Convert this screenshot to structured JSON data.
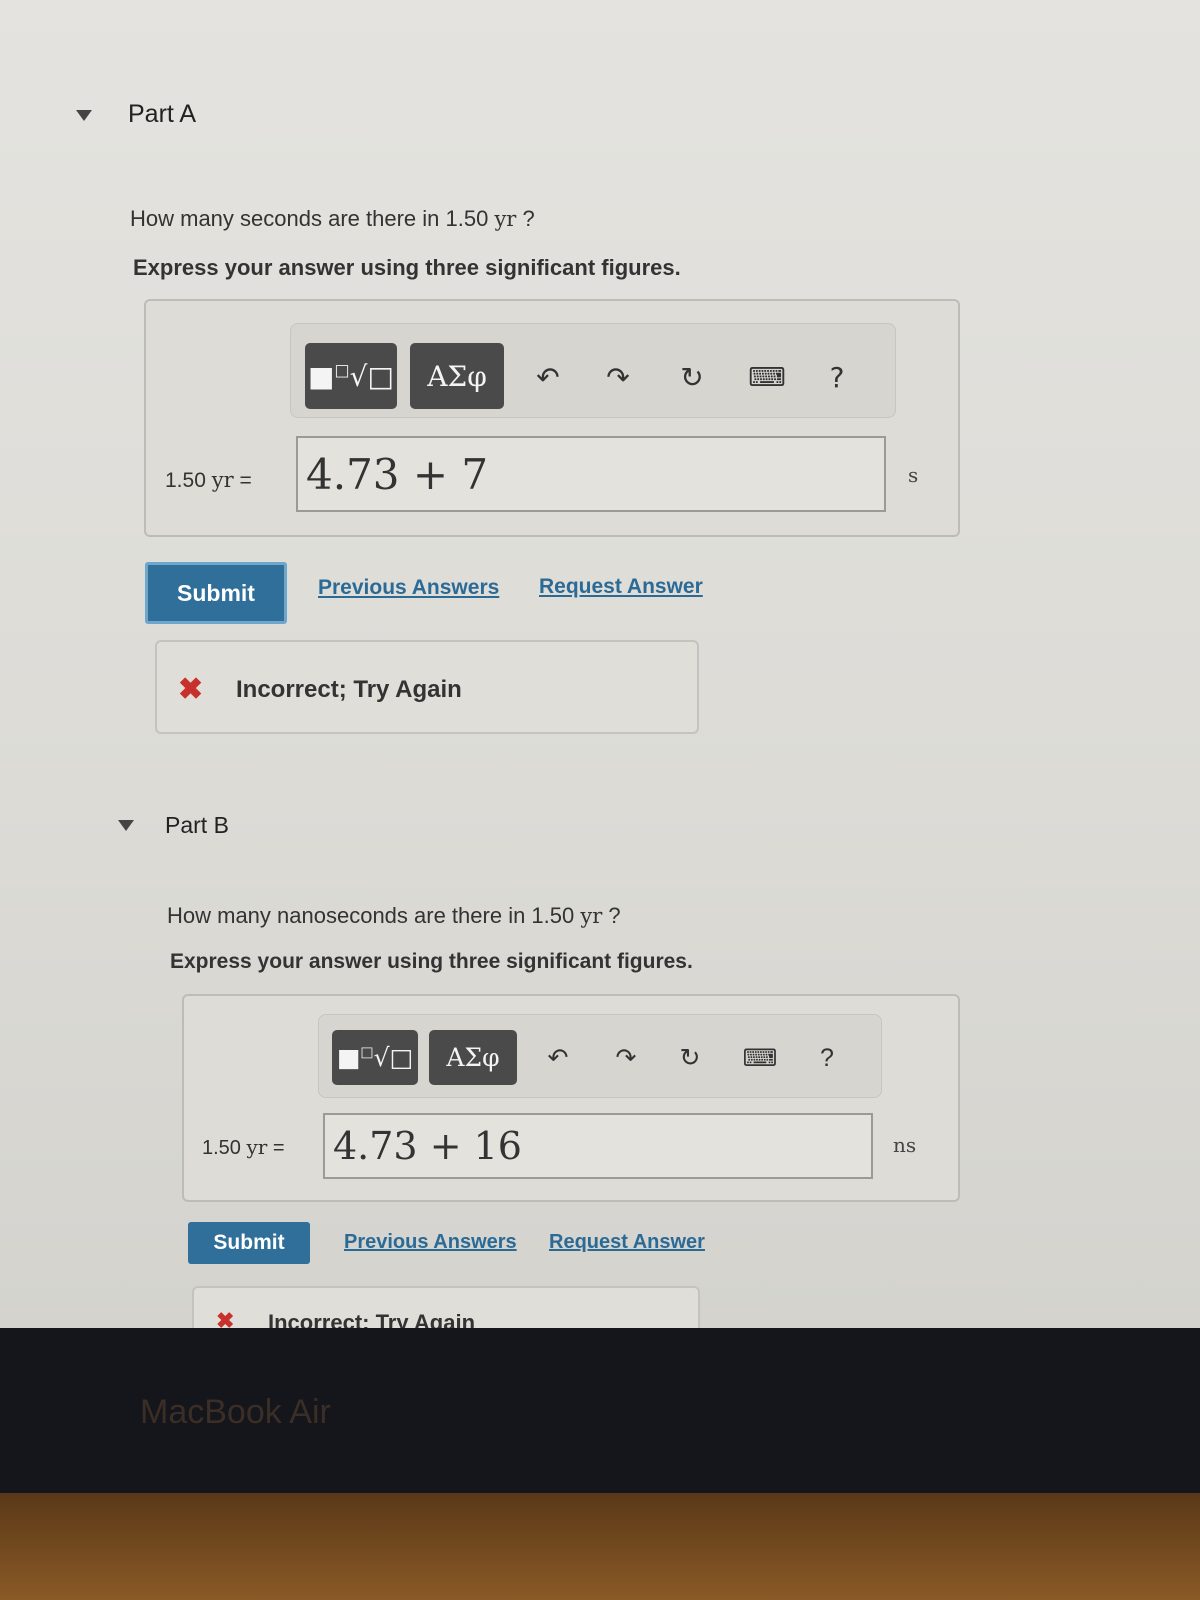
{
  "partA": {
    "title": "Part A",
    "question_prefix": "How many seconds are there in 1.50",
    "question_unit": "yr",
    "question_suffix": "?",
    "instruction": "Express your answer using three significant figures.",
    "toolbar": {
      "template_icon": "fraction-root-template-icon",
      "greek_label": "ΑΣφ",
      "icons": [
        "undo-icon",
        "redo-icon",
        "reset-icon",
        "keyboard-icon",
        "help-icon"
      ],
      "help_label": "?"
    },
    "input_label_value": "1.50",
    "input_label_unit": "yr",
    "input_label_eq": "=",
    "answer_value": "4.73 + 7",
    "answer_unit": "s",
    "submit_label": "Submit",
    "previous_answers_label": "Previous Answers",
    "request_answer_label": "Request Answer",
    "feedback": "Incorrect; Try Again"
  },
  "partB": {
    "title": "Part B",
    "question_prefix": "How many nanoseconds are there in 1.50",
    "question_unit": "yr",
    "question_suffix": "?",
    "instruction": "Express your answer using three significant figures.",
    "toolbar": {
      "greek_label": "ΑΣφ",
      "help_label": "?"
    },
    "input_label_value": "1.50",
    "input_label_unit": "yr",
    "input_label_eq": "=",
    "answer_value": "4.73 + 16",
    "answer_unit": "ns",
    "submit_label": "Submit",
    "previous_answers_label": "Previous Answers",
    "request_answer_label": "Request Answer",
    "feedback": "Incorrect; Try Again"
  },
  "device_label": "MacBook Air",
  "colors": {
    "submit": "#2f6f9a",
    "link": "#2c6a96",
    "error": "#c8302b"
  }
}
